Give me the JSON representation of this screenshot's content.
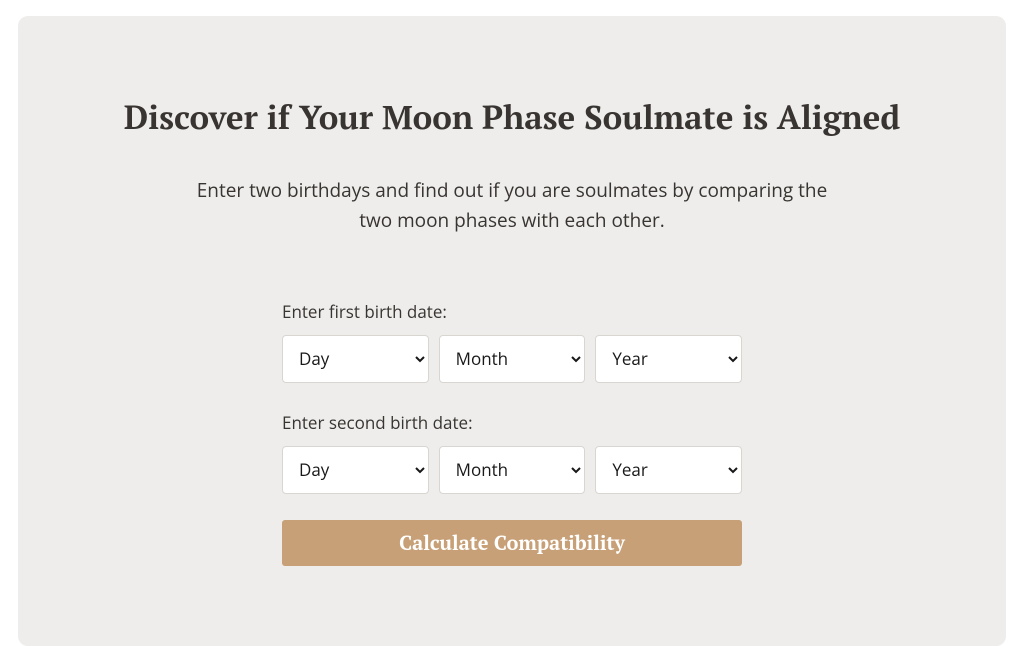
{
  "title": "Discover if Your Moon Phase Soulmate is Aligned",
  "subtitle": "Enter two birthdays and find out if you are soulmates by comparing the two moon phases with each other.",
  "form": {
    "first": {
      "label": "Enter first birth date:",
      "day": "Day",
      "month": "Month",
      "year": "Year"
    },
    "second": {
      "label": "Enter second birth date:",
      "day": "Day",
      "month": "Month",
      "year": "Year"
    },
    "submit": "Calculate Compatibility"
  }
}
